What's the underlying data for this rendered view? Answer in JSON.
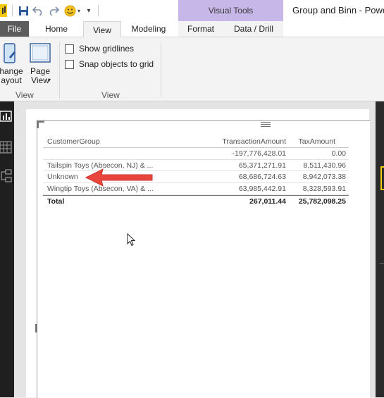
{
  "window": {
    "title": "Group and Binn - Power",
    "contextual_group": "Visual Tools"
  },
  "tabs": {
    "file": "File",
    "home": "Home",
    "view": "View",
    "modeling": "Modeling",
    "format": "Format",
    "data_drill": "Data / Drill"
  },
  "ribbon": {
    "change_layout": "hange\nayout",
    "page_view": "Page\nView",
    "show_gridlines": "Show gridlines",
    "snap_objects": "Snap objects to grid",
    "group_view_left": "View",
    "group_view_right": "View"
  },
  "table": {
    "headers": [
      "CustomerGroup",
      "TransactionAmount",
      "TaxAmount"
    ],
    "rows": [
      {
        "group": "",
        "transaction": "-197,776,428.01",
        "tax": "0.00"
      },
      {
        "group": "Tailspin Toys (Absecon, NJ) & ...",
        "transaction": "65,371,271.91",
        "tax": "8,511,430.96"
      },
      {
        "group": "Unknown",
        "transaction": "68,686,724.63",
        "tax": "8,942,073.38"
      },
      {
        "group": "Wingtip Toys (Absecon, VA) & ...",
        "transaction": "63,985,442.91",
        "tax": "8,328,593.91"
      }
    ],
    "total": {
      "label": "Total",
      "transaction": "267,011.44",
      "tax": "25,782,098.25"
    }
  },
  "colors": {
    "accent_purple": "#c7b7e8",
    "annotation_arrow": "#e8463c",
    "file_tab": "#5c5c5c"
  }
}
